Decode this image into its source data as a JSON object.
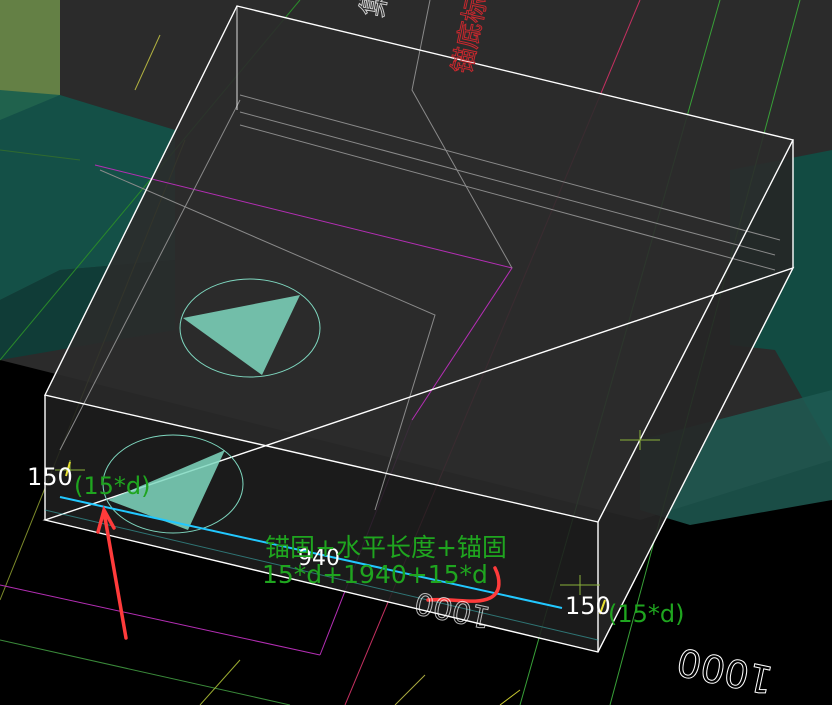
{
  "colors": {
    "background": "#000000",
    "slab_fill": "#2a2a2a",
    "wire": "#ffffff",
    "label_green": "#1fa51f",
    "dim_white": "#ffffff",
    "rebar_cyan": "#22c8ff",
    "annotation_red": "#ff3b3b",
    "red_text": "#c8282e",
    "magenta_line": "#b42eb4",
    "teal_block": "#0e4a40",
    "olive_block": "#6f8f4a"
  },
  "icons": [
    "triangle-marker-icon",
    "triangle-marker-icon",
    "red-arrow-annotation",
    "red-curve-annotation"
  ],
  "labels": {
    "dim_left": "150",
    "dim_left_formula": "(15*d)",
    "dim_right": "150",
    "dim_right_formula": "(15*d)",
    "mid_value": "940",
    "rebar_caption": "锚固+水平长度+锚固",
    "rebar_formula": "15*d+1940+15*d",
    "dim_1000": "1000",
    "dim_1000_small": "1000",
    "top_text": "集水",
    "red_top_text": "锚底标高"
  }
}
